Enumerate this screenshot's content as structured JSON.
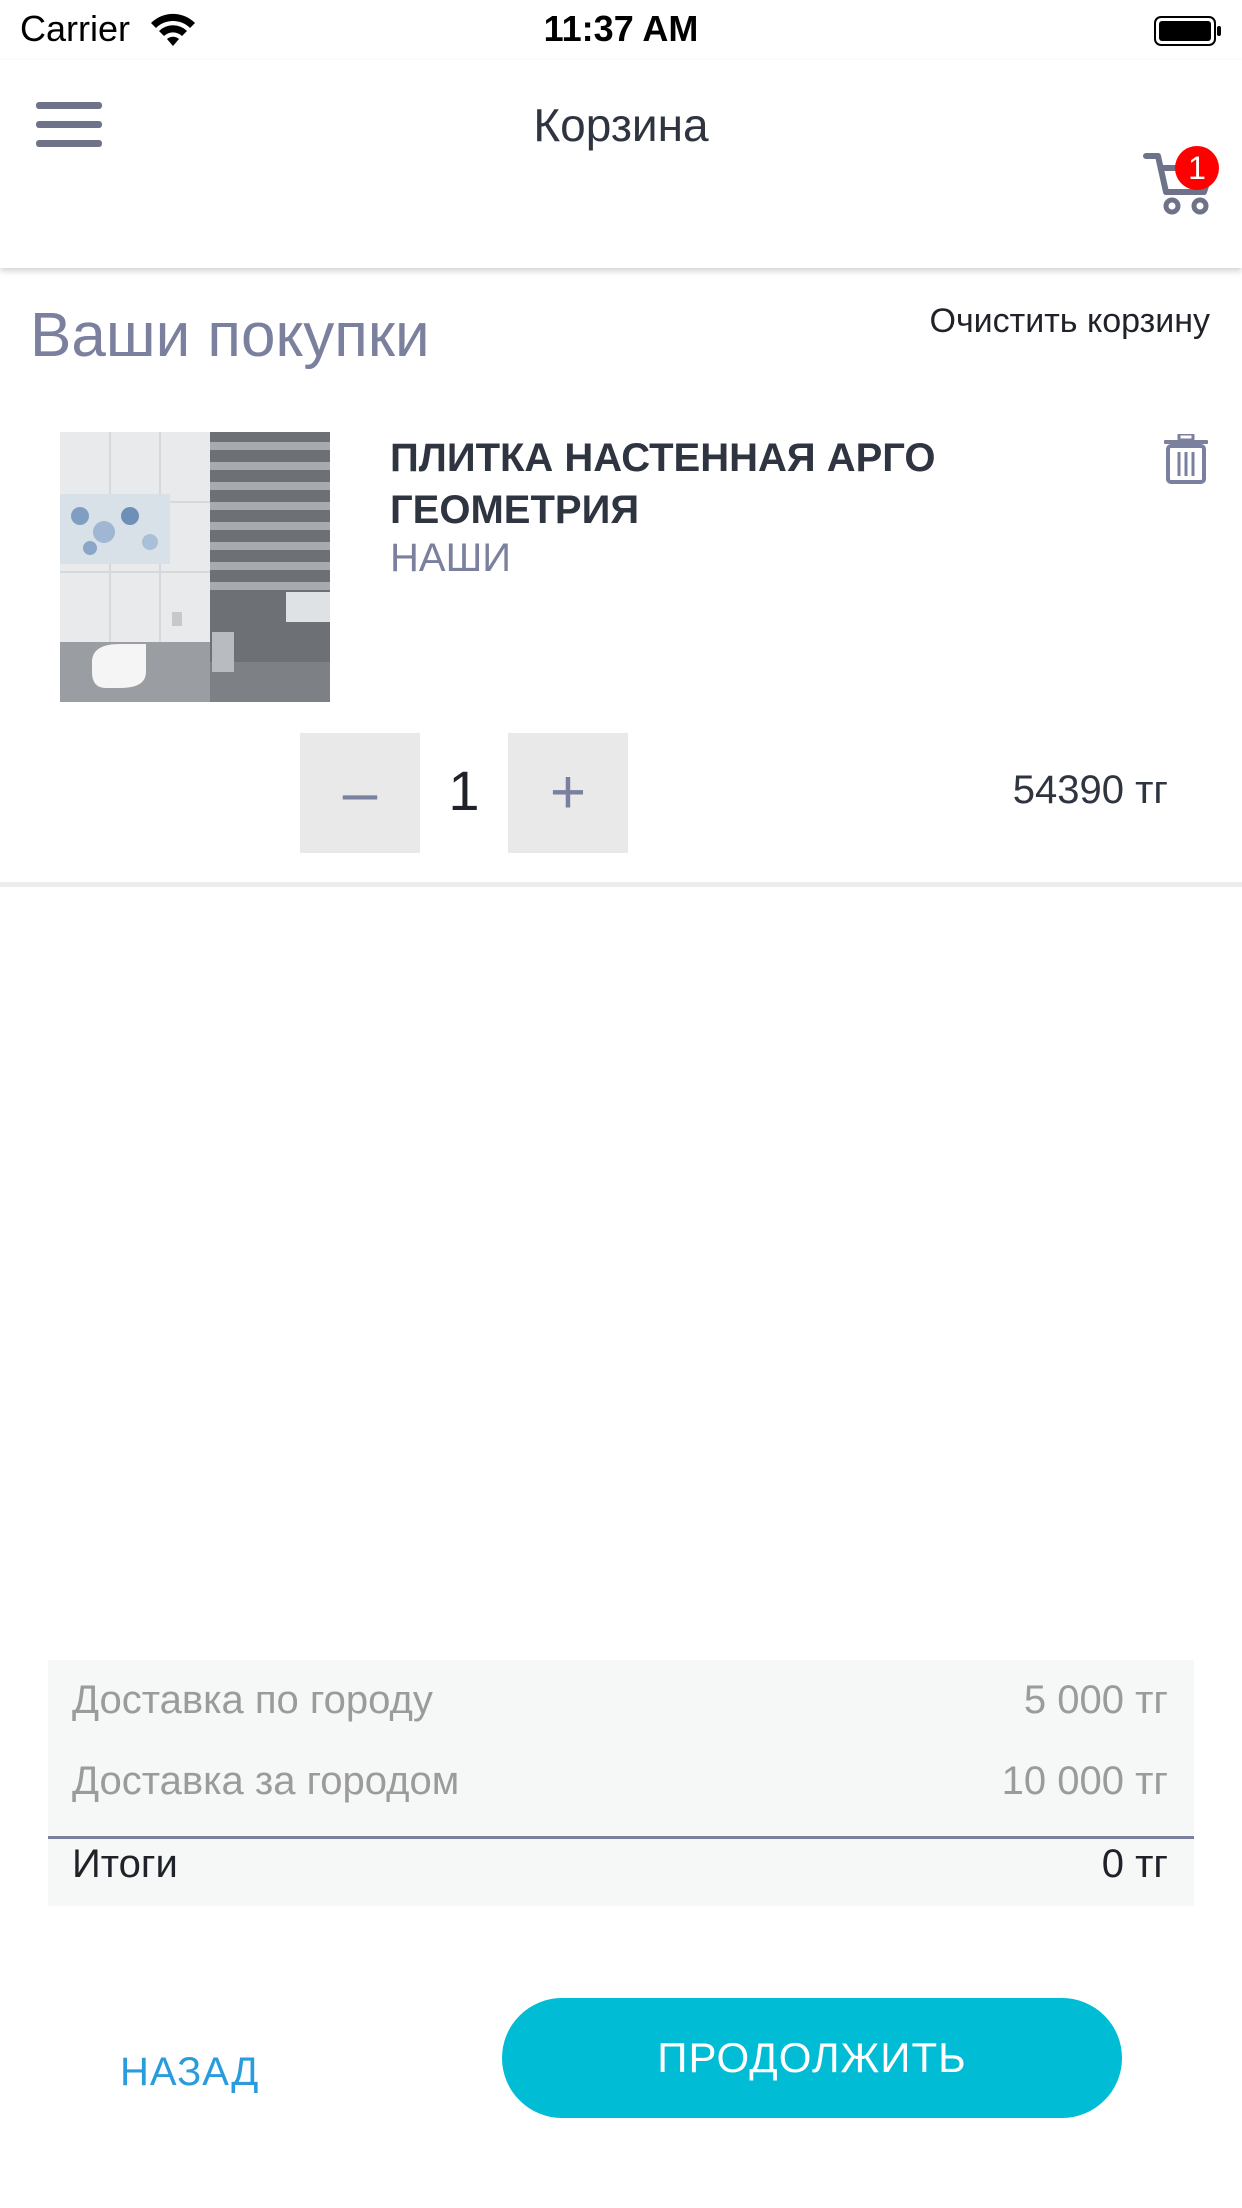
{
  "status_bar": {
    "carrier": "Carrier",
    "time": "11:37 AM"
  },
  "header": {
    "title": "Корзина",
    "cart_count": "1"
  },
  "cart": {
    "section_title": "Ваши покупки",
    "clear_label": "Очистить корзину",
    "items": [
      {
        "name": "ПЛИТКА НАСТЕННАЯ АРГО ГЕОМЕТРИЯ",
        "brand": "НАШИ",
        "quantity": "1",
        "minus": "–",
        "plus": "+",
        "price": "54390 тг"
      }
    ]
  },
  "totals": {
    "rows": [
      {
        "label": "Доставка по городу",
        "value": "5 000 тг"
      },
      {
        "label": "Доставка за городом",
        "value": "10 000 тг"
      }
    ],
    "total_label": "Итоги",
    "total_value": "0 тг"
  },
  "actions": {
    "back_label": "НАЗАД",
    "continue_label": "ПРОДОЛЖИТЬ"
  },
  "colors": {
    "accent": "#00bcd4",
    "link": "#2a9cde",
    "muted": "#7a809d",
    "badge": "#ff0000"
  },
  "icons": [
    "wifi-icon",
    "battery-icon",
    "menu-icon",
    "cart-icon",
    "trash-icon"
  ]
}
